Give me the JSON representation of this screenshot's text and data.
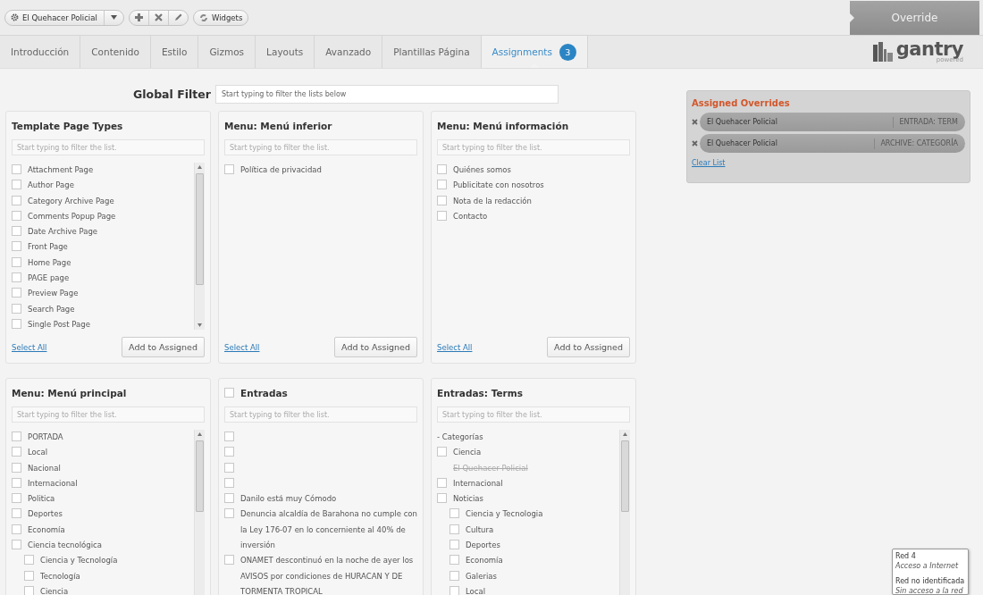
{
  "toolbar": {
    "template": "El Quehacer Policial",
    "widgets": "Widgets"
  },
  "override_tab": {
    "label": "Override"
  },
  "tabs": [
    {
      "label": "Introducción",
      "selected": false
    },
    {
      "label": "Contenido",
      "selected": false
    },
    {
      "label": "Estilo",
      "selected": false
    },
    {
      "label": "Gizmos",
      "selected": false
    },
    {
      "label": "Layouts",
      "selected": false
    },
    {
      "label": "Avanzado",
      "selected": false
    },
    {
      "label": "Plantillas Página",
      "selected": false
    },
    {
      "label": "Assignments",
      "selected": true,
      "badge": "3"
    }
  ],
  "logo": {
    "name": "gantry",
    "tagline": "powered"
  },
  "global_filter": {
    "label": "Global Filter",
    "placeholder": "Start typing to filter the lists below"
  },
  "panels": [
    {
      "title": "Template Page Types",
      "filter_placeholder": "Start typing to filter the list.",
      "items": [
        {
          "kind": "checkbox",
          "label": "Attachment Page",
          "checked": false
        },
        {
          "kind": "checkbox",
          "label": "Author Page",
          "checked": false
        },
        {
          "kind": "checkbox",
          "label": "Category Archive Page",
          "checked": false
        },
        {
          "kind": "checkbox",
          "label": "Comments Popup Page",
          "checked": false
        },
        {
          "kind": "checkbox",
          "label": "Date Archive Page",
          "checked": false
        },
        {
          "kind": "checkbox",
          "label": "Front Page",
          "checked": false
        },
        {
          "kind": "checkbox",
          "label": "Home Page",
          "checked": false
        },
        {
          "kind": "checkbox",
          "label": "PAGE page",
          "checked": false
        },
        {
          "kind": "checkbox",
          "label": "Preview Page",
          "checked": false
        },
        {
          "kind": "checkbox",
          "label": "Search Page",
          "checked": false
        },
        {
          "kind": "checkbox",
          "label": "Single Post Page",
          "checked": false
        }
      ],
      "select_all": "Select All",
      "add_button": "Add to Assigned"
    },
    {
      "title": "Menu: Menú inferior",
      "filter_placeholder": "Start typing to filter the list.",
      "items": [
        {
          "kind": "checkbox",
          "label": "Política de privacidad",
          "checked": false
        }
      ],
      "select_all": "Select All",
      "add_button": "Add to Assigned"
    },
    {
      "title": "Menu: Menú información",
      "filter_placeholder": "Start typing to filter the list.",
      "items": [
        {
          "kind": "checkbox",
          "label": "Quiénes somos",
          "checked": false
        },
        {
          "kind": "checkbox",
          "label": "Publicitate con nosotros",
          "checked": false
        },
        {
          "kind": "checkbox",
          "label": "Nota de la redacción",
          "checked": false
        },
        {
          "kind": "checkbox",
          "label": "Contacto",
          "checked": false
        }
      ],
      "select_all": "Select All",
      "add_button": "Add to Assigned"
    },
    {
      "title": "Menu: Menú principal",
      "filter_placeholder": "Start typing to filter the list.",
      "items": [
        {
          "kind": "checkbox",
          "label": "PORTADA",
          "checked": false
        },
        {
          "kind": "checkbox",
          "label": "Local",
          "checked": false
        },
        {
          "kind": "checkbox",
          "label": "Nacional",
          "checked": false
        },
        {
          "kind": "checkbox",
          "label": "Internacional",
          "checked": false
        },
        {
          "kind": "checkbox",
          "label": "Politica",
          "checked": false
        },
        {
          "kind": "checkbox",
          "label": "Deportes",
          "checked": false
        },
        {
          "kind": "checkbox",
          "label": "Economía",
          "checked": false
        },
        {
          "kind": "checkbox",
          "label": "Ciencia tecnológica",
          "checked": false,
          "children": [
            {
              "kind": "checkbox",
              "label": "Ciencia y Tecnología",
              "checked": false
            },
            {
              "kind": "checkbox",
              "label": "Tecnología",
              "checked": false
            },
            {
              "kind": "checkbox",
              "label": "Ciencia",
              "checked": false
            }
          ]
        }
      ]
    },
    {
      "title": "Entradas",
      "header_checkbox": {
        "checked": false
      },
      "filter_placeholder": "Start typing to filter the list.",
      "items": [
        {
          "kind": "checkbox",
          "checked": false
        },
        {
          "kind": "checkbox",
          "checked": false
        },
        {
          "kind": "checkbox",
          "checked": false
        },
        {
          "kind": "checkbox",
          "checked": false
        },
        {
          "kind": "checkbox",
          "label": "Danilo está muy Cómodo",
          "checked": false
        },
        {
          "kind": "checkbox",
          "label": "Denuncia alcaldía de Barahona no cumple con  la Ley 176-07 en lo concerniente al 40% de inversión",
          "checked": false
        },
        {
          "kind": "checkbox",
          "label": "ONAMET descontinuó en la noche de ayer los AVISOS por condiciones de HURACAN  Y DE TORMENTA TROPICAL",
          "checked": false
        }
      ]
    },
    {
      "title": "Entradas: Terms",
      "filter_placeholder": "Start typing to filter the list.",
      "items": [
        {
          "kind": "heading",
          "label": "- Categorías"
        },
        {
          "kind": "checkbox",
          "label": "Ciencia",
          "checked": false
        },
        {
          "kind": "assigned",
          "label": "El Quehacer Policial"
        },
        {
          "kind": "checkbox",
          "label": "Internacional",
          "checked": false
        },
        {
          "kind": "checkbox",
          "label": "Noticias",
          "checked": false,
          "children": [
            {
              "kind": "checkbox",
              "label": "Ciencia y Tecnologia",
              "checked": false
            },
            {
              "kind": "checkbox",
              "label": "Cultura",
              "checked": false
            },
            {
              "kind": "checkbox",
              "label": "Deportes",
              "checked": false
            },
            {
              "kind": "checkbox",
              "label": "Economía",
              "checked": false
            },
            {
              "kind": "checkbox",
              "label": "Galerias",
              "checked": false
            },
            {
              "kind": "checkbox",
              "label": "Local",
              "checked": false
            }
          ]
        }
      ]
    }
  ],
  "assigned_overrides": {
    "title": "Assigned Overrides",
    "items": [
      {
        "name": "El Quehacer Policial",
        "type": "ENTRADA: TERM"
      },
      {
        "name": "El Quehacer Policial",
        "type": "ARCHIVE: CATEGORÍA"
      }
    ],
    "clear": "Clear List"
  },
  "network_tooltip": {
    "sections": [
      {
        "lines": [
          {
            "text": "Red  4",
            "italic": false
          },
          {
            "text": "Acceso a Internet",
            "italic": true
          }
        ]
      },
      {
        "lines": [
          {
            "text": "Red no identificada",
            "italic": false
          },
          {
            "text": "Sin acceso a la red",
            "italic": true
          }
        ]
      }
    ]
  }
}
